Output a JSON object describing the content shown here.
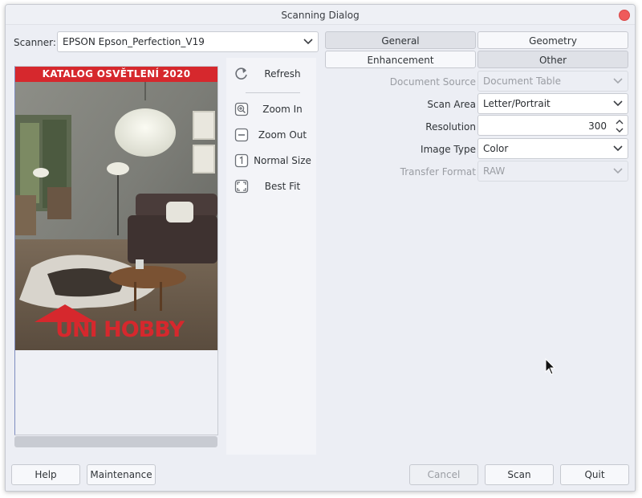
{
  "window": {
    "title": "Scanning Dialog"
  },
  "scanner": {
    "label": "Scanner:",
    "value": "EPSON Epson_Perfection_V19"
  },
  "preview": {
    "catalog_title": "KATALOG OSVĚTLENÍ 2020",
    "brand": "UNI HOBBY"
  },
  "tools": [
    {
      "label": "Refresh",
      "icon": "refresh-icon"
    },
    {
      "label": "Zoom In",
      "icon": "zoom-in-icon"
    },
    {
      "label": "Zoom Out",
      "icon": "zoom-out-icon"
    },
    {
      "label": "Normal Size",
      "icon": "normal-size-icon"
    },
    {
      "label": "Best Fit",
      "icon": "best-fit-icon"
    }
  ],
  "tabs": [
    {
      "label": "General",
      "selected": true
    },
    {
      "label": "Geometry",
      "selected": false
    },
    {
      "label": "Enhancement",
      "selected": false
    },
    {
      "label": "Other",
      "selected": true
    }
  ],
  "settings": {
    "document_source": {
      "label": "Document Source",
      "value": "Document Table"
    },
    "scan_area": {
      "label": "Scan Area",
      "value": "Letter/Portrait"
    },
    "resolution": {
      "label": "Resolution",
      "value": "300"
    },
    "image_type": {
      "label": "Image Type",
      "value": "Color"
    },
    "transfer_format": {
      "label": "Transfer Format",
      "value": "RAW"
    }
  },
  "buttons": {
    "help": "Help",
    "maintenance": "Maintenance",
    "cancel": "Cancel",
    "scan": "Scan",
    "quit": "Quit"
  },
  "colors": {
    "close": "#ef5b5b",
    "catalog_band": "#d6282d",
    "window_bg": "#eceef4"
  }
}
